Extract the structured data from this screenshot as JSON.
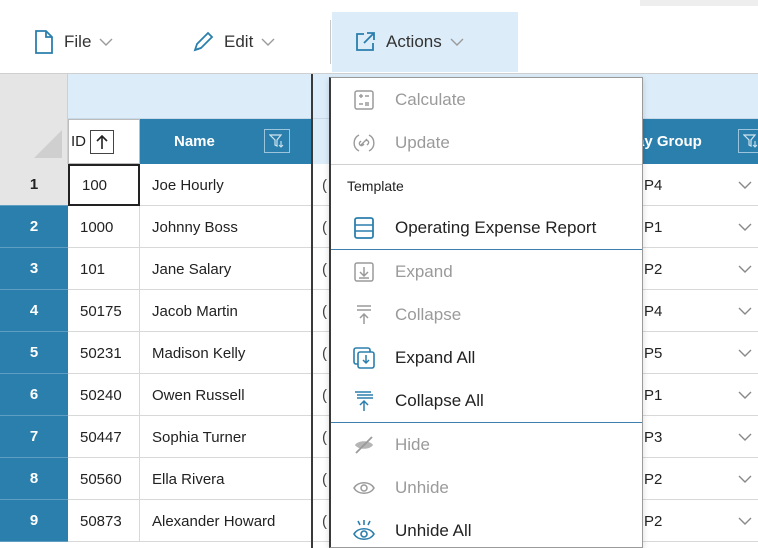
{
  "toolbar": {
    "file": {
      "label": "File",
      "icon": "file-icon"
    },
    "edit": {
      "label": "Edit",
      "icon": "pencil-icon"
    },
    "actions": {
      "label": "Actions",
      "icon": "external-link-icon"
    }
  },
  "grid": {
    "columns": {
      "id": "ID",
      "name": "Name",
      "pay_group": "ay Group"
    },
    "rows": [
      {
        "num": "1",
        "id": "100",
        "name": "Joe Hourly",
        "hidden": "(",
        "pay": "P4"
      },
      {
        "num": "2",
        "id": "1000",
        "name": "Johnny Boss",
        "hidden": "(",
        "pay": "P1"
      },
      {
        "num": "3",
        "id": "101",
        "name": "Jane Salary",
        "hidden": "(",
        "pay": "P2"
      },
      {
        "num": "4",
        "id": "50175",
        "name": "Jacob Martin",
        "hidden": "(",
        "pay": "P4"
      },
      {
        "num": "5",
        "id": "50231",
        "name": "Madison Kelly",
        "hidden": "(",
        "pay": "P5"
      },
      {
        "num": "6",
        "id": "50240",
        "name": "Owen Russell",
        "hidden": "(",
        "pay": "P1"
      },
      {
        "num": "7",
        "id": "50447",
        "name": "Sophia Turner",
        "hidden": "(",
        "pay": "P3"
      },
      {
        "num": "8",
        "id": "50560",
        "name": "Ella Rivera",
        "hidden": "(",
        "pay": "P2"
      },
      {
        "num": "9",
        "id": "50873",
        "name": "Alexander Howard",
        "hidden": "(",
        "pay": "P2"
      }
    ]
  },
  "menu": {
    "calculate": "Calculate",
    "update": "Update",
    "template_header": "Template",
    "operating_expense_report": "Operating Expense Report",
    "expand": "Expand",
    "collapse": "Collapse",
    "expand_all": "Expand All",
    "collapse_all": "Collapse All",
    "hide": "Hide",
    "unhide": "Unhide",
    "unhide_all": "Unhide All"
  },
  "colors": {
    "header_blue": "#2b7fad",
    "light_blue": "#dcecf9",
    "disabled_text": "#9a9a9a"
  }
}
